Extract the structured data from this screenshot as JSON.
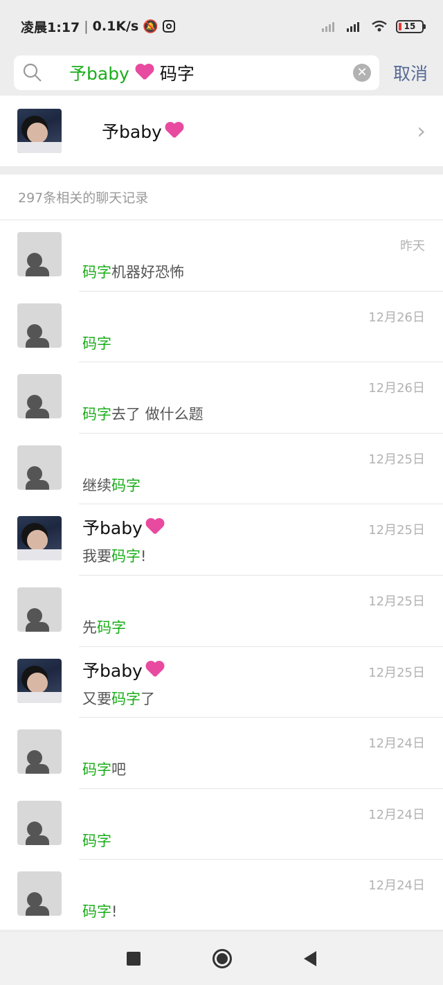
{
  "status_bar": {
    "time": "凌晨1:17",
    "speed": "0.1K/s",
    "battery": "15"
  },
  "search": {
    "query_name": "予baby",
    "query_keyword": "码字",
    "cancel_label": "取消"
  },
  "contact": {
    "name": "予baby"
  },
  "records": {
    "header": "297条相关的聊天记录",
    "items": [
      {
        "name": "",
        "pre": "",
        "kw": "码字",
        "post": "机器好恐怖",
        "time": "昨天",
        "avatar": "grey"
      },
      {
        "name": "",
        "pre": "",
        "kw": "码字",
        "post": "",
        "time": "12月26日",
        "avatar": "grey"
      },
      {
        "name": "",
        "pre": "",
        "kw": "码字",
        "post": "去了 做什么题",
        "time": "12月26日",
        "avatar": "grey"
      },
      {
        "name": "",
        "pre": "继续",
        "kw": "码字",
        "post": "",
        "time": "12月25日",
        "avatar": "grey"
      },
      {
        "name": "予baby",
        "pre": "我要",
        "kw": "码字",
        "post": "!",
        "time": "12月25日",
        "avatar": "girl"
      },
      {
        "name": "",
        "pre": "先",
        "kw": "码字",
        "post": "",
        "time": "12月25日",
        "avatar": "grey"
      },
      {
        "name": "予baby",
        "pre": "又要",
        "kw": "码字",
        "post": "了",
        "time": "12月25日",
        "avatar": "girl"
      },
      {
        "name": "",
        "pre": "",
        "kw": "码字",
        "post": "吧",
        "time": "12月24日",
        "avatar": "grey"
      },
      {
        "name": "",
        "pre": "",
        "kw": "码字",
        "post": "",
        "time": "12月24日",
        "avatar": "grey"
      },
      {
        "name": "",
        "pre": "",
        "kw": "码字",
        "post": "!",
        "time": "12月24日",
        "avatar": "grey"
      }
    ]
  },
  "icons": {
    "search": "search-icon",
    "clear": "clear-icon",
    "chevron": "chevron-right-icon",
    "heart": "heart-emoji-icon"
  }
}
